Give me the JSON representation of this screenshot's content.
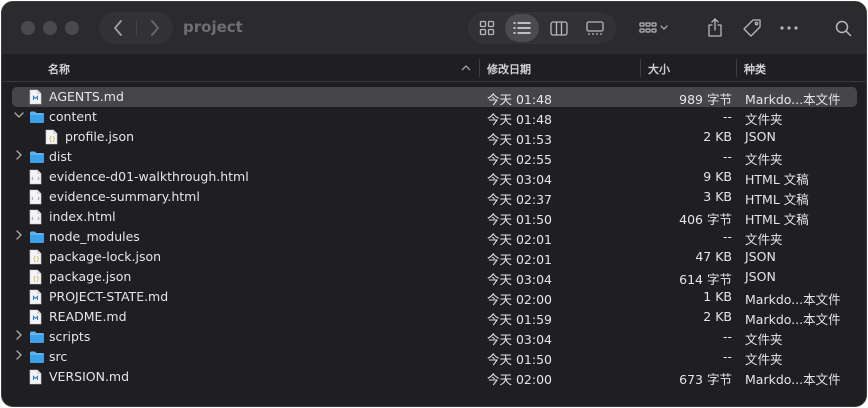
{
  "window": {
    "title": "project"
  },
  "toolbar": {
    "icons": [
      "back-icon",
      "forward-icon",
      "icon-view-icon",
      "list-view-icon",
      "column-view-icon",
      "gallery-view-icon",
      "group-icon",
      "share-icon",
      "tag-icon",
      "more-icon",
      "search-icon"
    ]
  },
  "columns": {
    "name": "名称",
    "date": "修改日期",
    "size": "大小",
    "kind": "种类"
  },
  "rows": [
    {
      "name": "AGENTS.md",
      "date": "今天 01:48",
      "size": "989 字节",
      "kind": "Markdo...本文件",
      "type": "md",
      "expand": "none",
      "indent": 0,
      "selected": true
    },
    {
      "name": "content",
      "date": "今天 01:48",
      "size": "--",
      "kind": "文件夹",
      "type": "folder",
      "expand": "open",
      "indent": 0,
      "selected": false
    },
    {
      "name": "profile.json",
      "date": "今天 01:53",
      "size": "2 KB",
      "kind": "JSON",
      "type": "json",
      "expand": "none",
      "indent": 1,
      "selected": false
    },
    {
      "name": "dist",
      "date": "今天 02:55",
      "size": "--",
      "kind": "文件夹",
      "type": "folder",
      "expand": "closed",
      "indent": 0,
      "selected": false
    },
    {
      "name": "evidence-d01-walkthrough.html",
      "date": "今天 03:04",
      "size": "9 KB",
      "kind": "HTML 文稿",
      "type": "html",
      "expand": "none",
      "indent": 0,
      "selected": false
    },
    {
      "name": "evidence-summary.html",
      "date": "今天 02:37",
      "size": "3 KB",
      "kind": "HTML 文稿",
      "type": "html",
      "expand": "none",
      "indent": 0,
      "selected": false
    },
    {
      "name": "index.html",
      "date": "今天 01:50",
      "size": "406 字节",
      "kind": "HTML 文稿",
      "type": "html",
      "expand": "none",
      "indent": 0,
      "selected": false
    },
    {
      "name": "node_modules",
      "date": "今天 02:01",
      "size": "--",
      "kind": "文件夹",
      "type": "folder",
      "expand": "closed",
      "indent": 0,
      "selected": false
    },
    {
      "name": "package-lock.json",
      "date": "今天 02:01",
      "size": "47 KB",
      "kind": "JSON",
      "type": "json",
      "expand": "none",
      "indent": 0,
      "selected": false
    },
    {
      "name": "package.json",
      "date": "今天 03:04",
      "size": "614 字节",
      "kind": "JSON",
      "type": "json",
      "expand": "none",
      "indent": 0,
      "selected": false
    },
    {
      "name": "PROJECT-STATE.md",
      "date": "今天 02:00",
      "size": "1 KB",
      "kind": "Markdo...本文件",
      "type": "md",
      "expand": "none",
      "indent": 0,
      "selected": false
    },
    {
      "name": "README.md",
      "date": "今天 01:59",
      "size": "2 KB",
      "kind": "Markdo...本文件",
      "type": "md",
      "expand": "none",
      "indent": 0,
      "selected": false
    },
    {
      "name": "scripts",
      "date": "今天 03:04",
      "size": "--",
      "kind": "文件夹",
      "type": "folder",
      "expand": "closed",
      "indent": 0,
      "selected": false
    },
    {
      "name": "src",
      "date": "今天 01:50",
      "size": "--",
      "kind": "文件夹",
      "type": "folder",
      "expand": "closed",
      "indent": 0,
      "selected": false
    },
    {
      "name": "VERSION.md",
      "date": "今天 02:00",
      "size": "673 字节",
      "kind": "Markdo...本文件",
      "type": "md",
      "expand": "none",
      "indent": 0,
      "selected": false
    }
  ]
}
